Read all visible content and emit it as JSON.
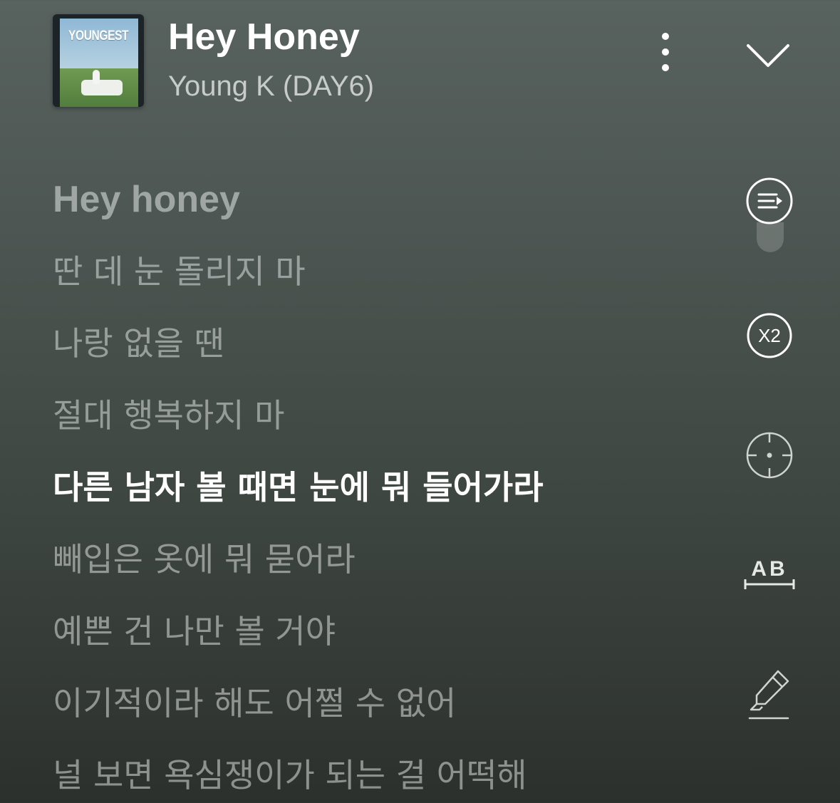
{
  "colors": {
    "active_lyric": "#ffffff",
    "inactive_lyric": "#a9aeac",
    "background_top": "#58625f",
    "background_bottom": "#2c302d"
  },
  "now_playing": {
    "album_text": "YOUNGEST",
    "title": "Hey Honey",
    "artist": "Young K (DAY6)",
    "more_icon": "more-vertical-icon",
    "collapse_icon": "chevron-down-icon"
  },
  "lyrics": [
    {
      "text": "Hey honey",
      "active": false
    },
    {
      "text": "딴 데 눈 돌리지 마",
      "active": false
    },
    {
      "text": "나랑 없을 땐",
      "active": false
    },
    {
      "text": "절대 행복하지 마",
      "active": false
    },
    {
      "text": "다른 남자 볼 때면 눈에 뭐 들어가라",
      "active": true
    },
    {
      "text": "빼입은 옷에 뭐 묻어라",
      "active": false
    },
    {
      "text": "예쁜 건 나만 볼 거야",
      "active": false
    },
    {
      "text": "이기적이라 해도 어쩔 수 없어",
      "active": false
    },
    {
      "text": "널 보면 욕심쟁이가 되는 걸 어떡해",
      "active": false
    }
  ],
  "side_controls": {
    "playlist_icon": "playlist-play-icon",
    "speed_label": "X2",
    "focus_icon": "crosshair-icon",
    "ab_label": "AB",
    "highlight_icon": "highlighter-icon"
  }
}
